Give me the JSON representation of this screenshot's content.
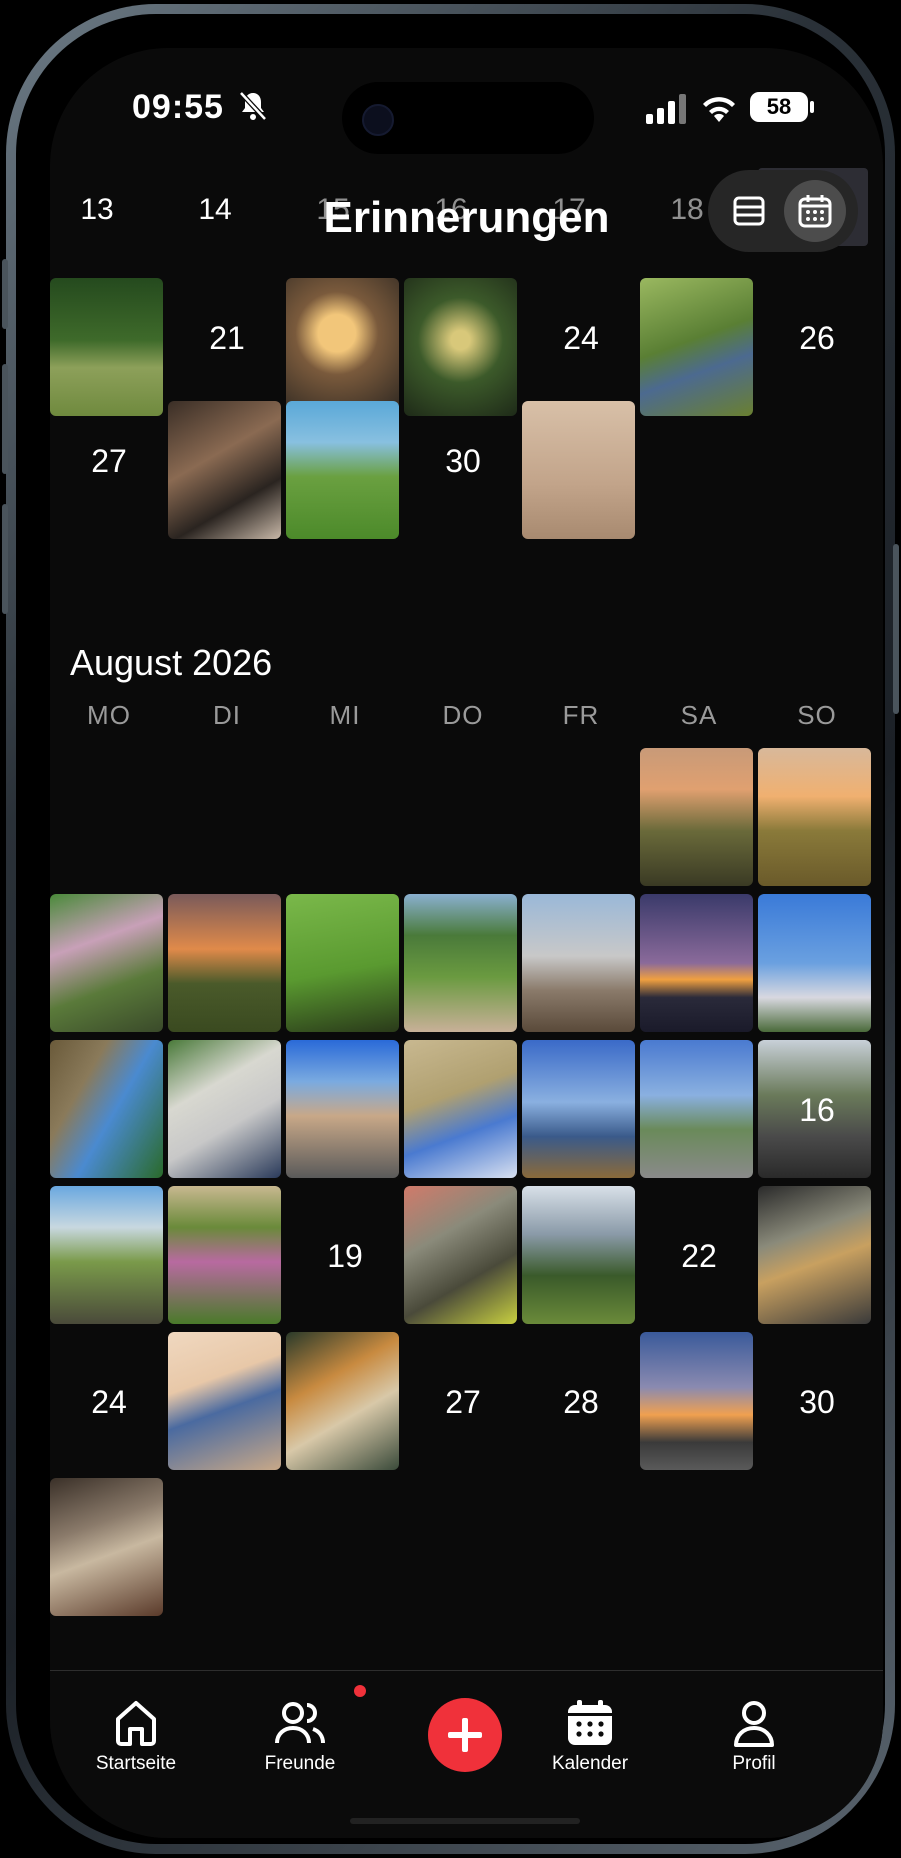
{
  "status_bar": {
    "time": "09:55",
    "battery": "58"
  },
  "header": {
    "title": "Erinnerungen",
    "week_numbers": [
      "13",
      "14",
      "15",
      "16",
      "17",
      "18"
    ]
  },
  "view_toggle": {
    "options": [
      "list-view",
      "calendar-view"
    ],
    "selected": "calendar-view"
  },
  "july": {
    "visible_date_labels": [
      "21",
      "24",
      "26",
      "27",
      "30"
    ],
    "photo_days": [
      "20",
      "22",
      "23",
      "25",
      "28",
      "29",
      "31"
    ]
  },
  "august": {
    "title": "August 2026",
    "weekdays": [
      "MO",
      "DI",
      "MI",
      "DO",
      "FR",
      "SA",
      "SO"
    ],
    "date_labels": [
      "16",
      "19",
      "22",
      "24",
      "27",
      "28",
      "30"
    ],
    "highlighted_day": "16"
  },
  "tabbar": {
    "items": [
      {
        "label": "Startseite",
        "icon": "home-icon"
      },
      {
        "label": "Freunde",
        "icon": "friends-icon",
        "badge": true
      },
      {
        "label": "",
        "icon": "plus-icon"
      },
      {
        "label": "Kalender",
        "icon": "calendar-icon"
      },
      {
        "label": "Profil",
        "icon": "profile-icon"
      }
    ]
  },
  "colors": {
    "background": "#0a0a0a",
    "accent": "#f0313a",
    "text": "#ffffff",
    "muted": "#9a9a9a"
  }
}
